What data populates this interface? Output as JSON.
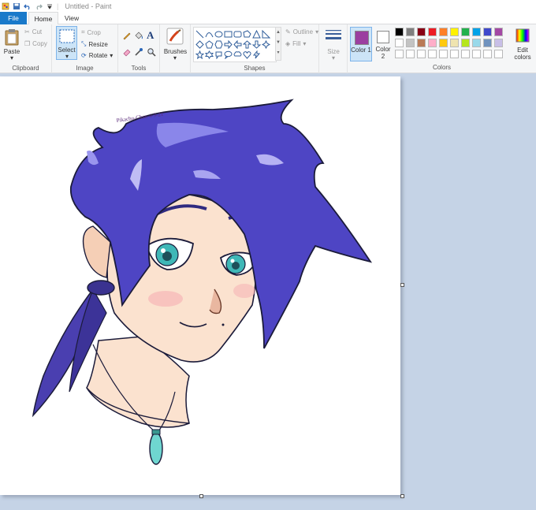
{
  "window": {
    "title": "Untitled - Paint"
  },
  "tabs": {
    "file": "File",
    "home": "Home",
    "view": "View"
  },
  "clipboard": {
    "paste": "Paste",
    "cut": "Cut",
    "copy": "Copy",
    "group": "Clipboard"
  },
  "image": {
    "select": "Select",
    "crop": "Crop",
    "resize": "Resize",
    "rotate": "Rotate",
    "group": "Image"
  },
  "tools": {
    "group": "Tools"
  },
  "brushes": {
    "label": "Brushes"
  },
  "shapes": {
    "outline": "Outline",
    "fill": "Fill",
    "group": "Shapes"
  },
  "size": {
    "label": "Size"
  },
  "color1": {
    "label": "Color 1",
    "value": "#9b3fa0"
  },
  "color2": {
    "label": "Color 2",
    "value": "#ffffff"
  },
  "colors": {
    "group": "Colors",
    "edit": "Edit colors",
    "palette_row1": [
      "#000000",
      "#7f7f7f",
      "#880015",
      "#ed1c24",
      "#ff7f27",
      "#fff200",
      "#22b14c",
      "#00a2e8",
      "#3f48cc",
      "#a349a4"
    ],
    "palette_row2": [
      "#ffffff",
      "#c3c3c3",
      "#b97a57",
      "#ffaec9",
      "#ffc90e",
      "#efe4b0",
      "#b5e61d",
      "#99d9ea",
      "#7092be",
      "#c8bfe7"
    ],
    "palette_row3": [
      "#ffffff",
      "#ffffff",
      "#ffffff",
      "#ffffff",
      "#ffffff",
      "#ffffff",
      "#ffffff",
      "#ffffff",
      "#ffffff",
      "#ffffff"
    ]
  },
  "drawing": {
    "signature": "Pikachu-Chan 4-9-21"
  }
}
